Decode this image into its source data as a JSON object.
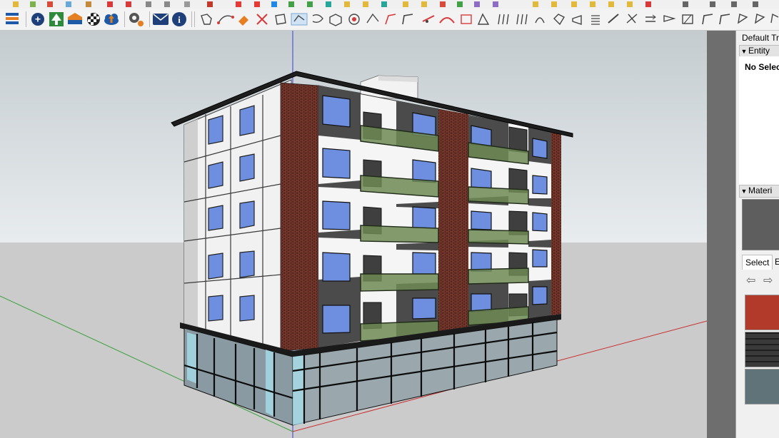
{
  "toolbar": {
    "row1_icons": [
      "pencil-icon",
      "pencil-icon",
      "pencil-icon",
      "pencil-icon",
      "pencil-icon",
      "pencil-icon",
      "file-icon",
      "flag-icon",
      "flag-icon",
      "link-icon",
      "tool-icon",
      "pin-icon",
      "add-icon",
      "add-icon",
      "arrow-icon",
      "cube-icon",
      "diamond-icon",
      "component-icon",
      "component-icon",
      "component-icon",
      "component-icon",
      "component-icon",
      "component-icon",
      "shape-icon",
      "shape-icon",
      "shape-icon",
      "grid-icon",
      "close-icon",
      "star-icon",
      "window-icon",
      "window-icon",
      "window-icon",
      "window-icon"
    ],
    "row2_group1": [
      "layers-icon",
      "add-circle-icon",
      "tree-icon",
      "warehouse-icon",
      "checker-icon",
      "cloud-upload-icon",
      "gear-icon",
      "mail-icon",
      "info-icon"
    ],
    "row2_group2": [
      "tool-1-icon",
      "tool-2-icon",
      "tool-3-icon",
      "tool-4-icon",
      "tool-5-icon",
      "tool-6-icon",
      "tool-7-icon",
      "tool-8-icon",
      "tool-9-icon",
      "tool-10-icon",
      "tool-11-icon",
      "tool-12-icon",
      "tool-13-icon",
      "tool-14-icon",
      "tool-15-icon",
      "tool-16-icon",
      "tool-17-icon",
      "tool-18-icon",
      "tool-19-icon",
      "tool-20-icon",
      "tool-21-icon",
      "tool-22-icon",
      "tool-23-icon",
      "tool-24-icon",
      "tool-25-icon",
      "tool-26-icon",
      "tool-27-icon",
      "tool-28-icon",
      "tool-29-icon",
      "tool-30-icon",
      "tool-31-icon",
      "tool-32-icon",
      "tool-33-icon",
      "tool-34-icon",
      "tool-35-icon"
    ]
  },
  "tray": {
    "title": "Default Tra",
    "entity_header": "Entity",
    "no_selection": "No Selec",
    "materials_header": "Materi",
    "tabs": [
      "Select",
      "Ed"
    ]
  },
  "colors": {
    "accent_red": "#b23a2b",
    "brick": "#5a2a22",
    "glass": "#9fd4e8",
    "balcony": "#6f8a55"
  }
}
